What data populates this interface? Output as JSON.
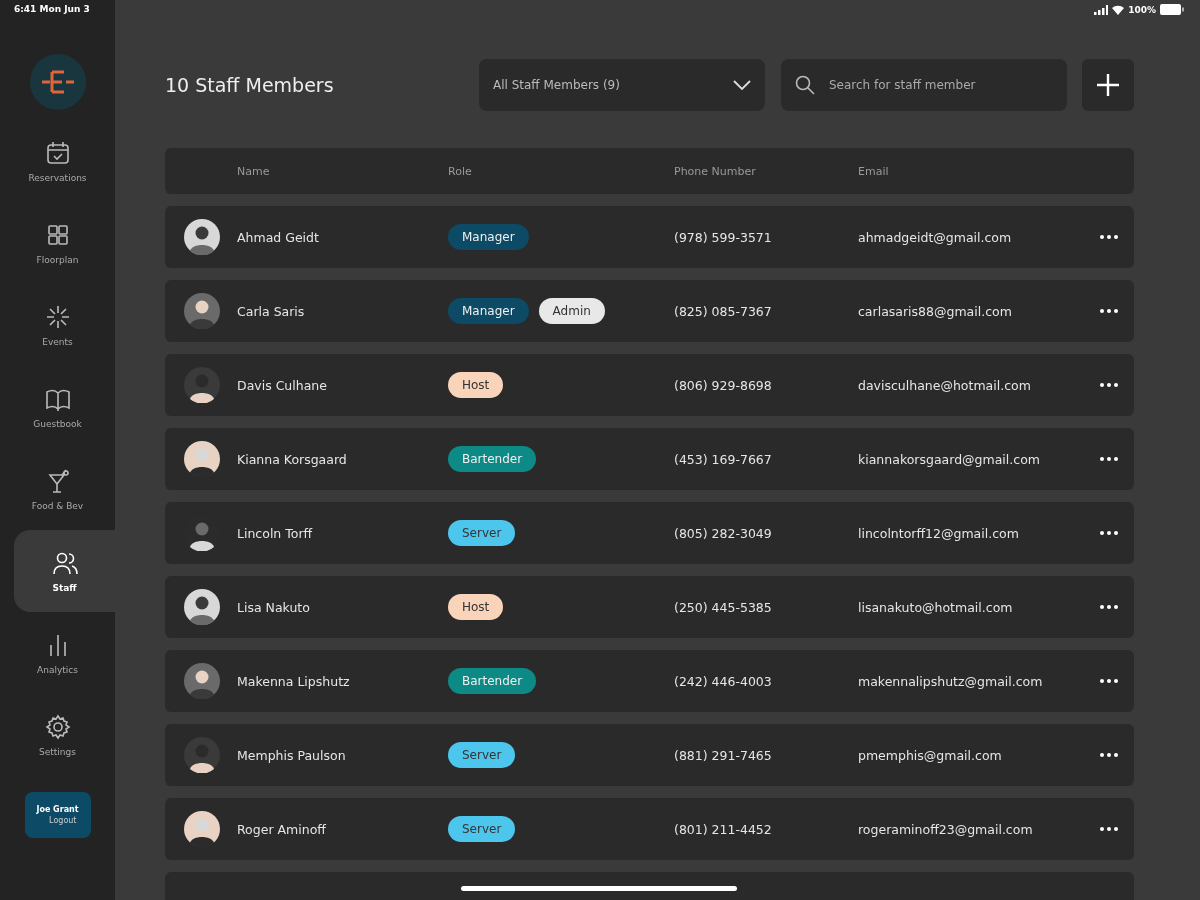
{
  "status_bar": {
    "time": "6:41 Mon Jun 3",
    "battery": "100%"
  },
  "sidebar": {
    "items": [
      {
        "label": "Reservations",
        "kind": "calendar",
        "selected": false
      },
      {
        "label": "Floorplan",
        "kind": "grid",
        "selected": false
      },
      {
        "label": "Events",
        "kind": "sparkle",
        "selected": false
      },
      {
        "label": "Guestbook",
        "kind": "book",
        "selected": false
      },
      {
        "label": "Food & Bev",
        "kind": "cocktail",
        "selected": false
      },
      {
        "label": "Staff",
        "kind": "people",
        "selected": true
      },
      {
        "label": "Analytics",
        "kind": "bars",
        "selected": false
      },
      {
        "label": "Settings",
        "kind": "gear",
        "selected": false
      }
    ],
    "user": {
      "name": "Joe Grant",
      "action": "Logout"
    }
  },
  "header": {
    "title": "10 Staff Members",
    "filter": "All Staff Members (9)",
    "search": {
      "placeholder": "Search for staff member"
    }
  },
  "table": {
    "columns": [
      "Name",
      "Role",
      "Phone Number",
      "Email"
    ],
    "rows": [
      {
        "name": "Ahmad Geidt",
        "roles": [
          {
            "label": "Manager",
            "color": "#0d4a66"
          }
        ],
        "phone": "(978) 599-3571",
        "email": "ahmadgeidt@gmail.com"
      },
      {
        "name": "Carla Saris",
        "roles": [
          {
            "label": "Manager",
            "color": "#0d4a66"
          },
          {
            "label": "Admin",
            "color": "#e8e8e8"
          }
        ],
        "phone": "(825) 085-7367",
        "email": "carlasaris88@gmail.com"
      },
      {
        "name": "Davis Culhane",
        "roles": [
          {
            "label": "Host",
            "color": "#f9d4ba"
          }
        ],
        "phone": "(806) 929-8698",
        "email": "davisculhane@hotmail.com"
      },
      {
        "name": "Kianna Korsgaard",
        "roles": [
          {
            "label": "Bartender",
            "color": "#0e8a86"
          }
        ],
        "phone": "(453) 169-7667",
        "email": "kiannakorsgaard@gmail.com"
      },
      {
        "name": "Lincoln Torff",
        "roles": [
          {
            "label": "Server",
            "color": "#4dc6ee"
          }
        ],
        "phone": "(805) 282-3049",
        "email": "lincolntorff12@gmail.com"
      },
      {
        "name": "Lisa Nakuto",
        "roles": [
          {
            "label": "Host",
            "color": "#f9d4ba"
          }
        ],
        "phone": "(250) 445-5385",
        "email": "lisanakuto@hotmail.com"
      },
      {
        "name": "Makenna Lipshutz",
        "roles": [
          {
            "label": "Bartender",
            "color": "#0e8a86"
          }
        ],
        "phone": "(242) 446-4003",
        "email": "makennalipshutz@gmail.com"
      },
      {
        "name": "Memphis Paulson",
        "roles": [
          {
            "label": "Server",
            "color": "#4dc6ee"
          }
        ],
        "phone": "(881) 291-7465",
        "email": "pmemphis@gmail.com"
      },
      {
        "name": "Roger Aminoff",
        "roles": [
          {
            "label": "Server",
            "color": "#4dc6ee"
          }
        ],
        "phone": "(801) 211-4452",
        "email": "rogeraminoff23@gmail.com"
      }
    ]
  }
}
